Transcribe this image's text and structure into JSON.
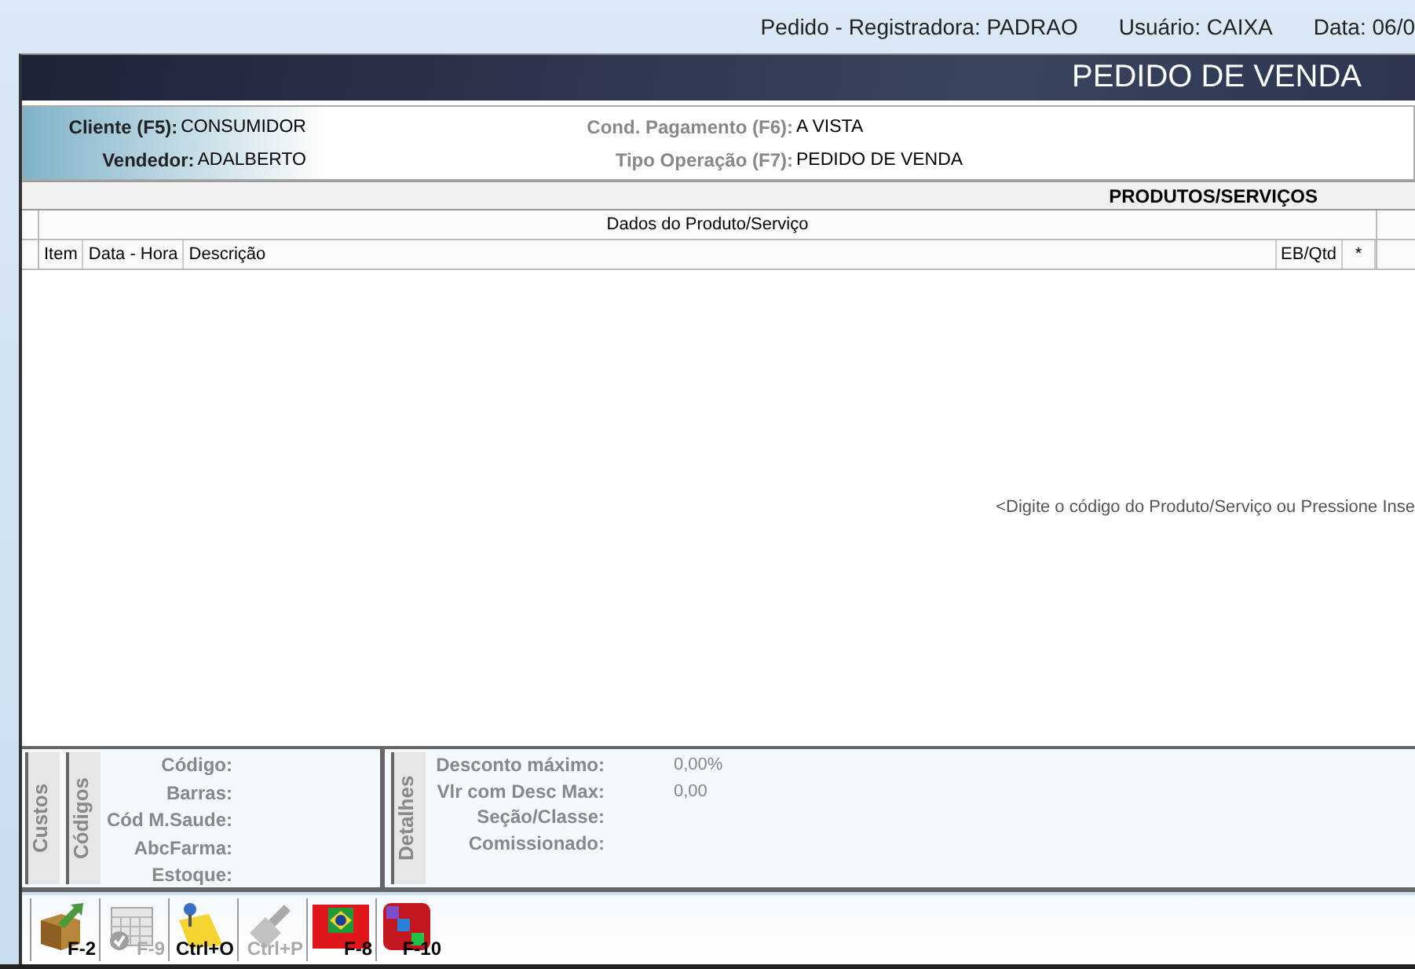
{
  "window": {
    "title_bar": [
      "Pedido - Registradora: PADRAO",
      "Usuário: CAIXA",
      "Data: 06/0"
    ]
  },
  "banner": {
    "title": "PEDIDO DE VENDA"
  },
  "header_fields": [
    {
      "label": "Cliente (F5):",
      "value": "CONSUMIDOR",
      "kind": "primary"
    },
    {
      "label": "Cond. Pagamento (F6):",
      "value": "A VISTA",
      "kind": "secondary"
    },
    {
      "label": "Vendedor:",
      "value": "ADALBERTO",
      "kind": "primary"
    },
    {
      "label": "Tipo Operação (F7):",
      "value": "PEDIDO DE VENDA",
      "kind": "secondary"
    }
  ],
  "products": {
    "title": "PRODUTOS/SERVIÇOS",
    "group_header": "Dados do Produto/Serviço",
    "columns": [
      "Item",
      "Data - Hora",
      "Descrição",
      "EB/Qtd",
      "*"
    ],
    "hint": "<Digite o código do Produto/Serviço ou Pressione Inse"
  },
  "details": {
    "tabs": [
      "Custos",
      "Códigos"
    ],
    "codes": [
      "Código:",
      "Barras:",
      "Cód M.Saude:",
      "AbcFarma:",
      "Estoque:"
    ],
    "side_tab": "Detalhes",
    "fields": [
      {
        "label": "Desconto máximo:",
        "value": "0,00%"
      },
      {
        "label": "Vlr com Desc Max:",
        "value": "0,00"
      },
      {
        "label": "Seção/Classe:"
      },
      {
        "label": "Comissionado:"
      }
    ]
  },
  "toolbar": [
    {
      "kind": "box",
      "label": "F-2",
      "disabled": false
    },
    {
      "kind": "calendar",
      "label": "F-9",
      "disabled": true
    },
    {
      "kind": "note",
      "label": "Ctrl+O",
      "disabled": false
    },
    {
      "kind": "stamp",
      "label": "Ctrl+P",
      "disabled": true
    },
    {
      "kind": "flag",
      "label": "F-8",
      "disabled": false
    },
    {
      "kind": "pbm",
      "label": "F-10",
      "disabled": false
    }
  ]
}
